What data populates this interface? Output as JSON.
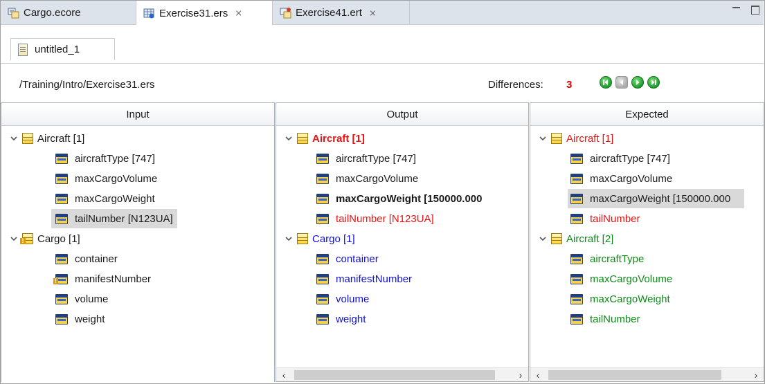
{
  "editor_tabs": [
    {
      "label": "Cargo.ecore",
      "icon": "ecore-model-icon"
    },
    {
      "label": "Exercise31.ers",
      "icon": "ers-file-icon"
    },
    {
      "label": "Exercise41.ert",
      "icon": "ert-file-icon"
    }
  ],
  "close_glyph": "⨯",
  "sub_tab": {
    "label": "untitled_1"
  },
  "path": "/Training/Intro/Exercise31.ers",
  "differences": {
    "label": "Differences:",
    "count": "3"
  },
  "colors": {
    "added": "#0b8a16",
    "removed": "#ee1111",
    "changed": "#1010dd"
  },
  "panels": {
    "input": {
      "title": "Input",
      "rows": [
        {
          "label": "Aircraft [1]"
        },
        {
          "label": "aircraftType [747]"
        },
        {
          "label": "maxCargoVolume"
        },
        {
          "label": "maxCargoWeight"
        },
        {
          "label": "tailNumber [N123UA]"
        },
        {
          "label": "Cargo [1]"
        },
        {
          "label": "container"
        },
        {
          "label": "manifestNumber"
        },
        {
          "label": "volume"
        },
        {
          "label": "weight"
        }
      ]
    },
    "output": {
      "title": "Output",
      "rows": [
        {
          "label": "Aircraft [1]"
        },
        {
          "label": "aircraftType [747]"
        },
        {
          "label": "maxCargoVolume"
        },
        {
          "label": "maxCargoWeight [150000.000"
        },
        {
          "label": "tailNumber [N123UA]"
        },
        {
          "label": "Cargo [1]"
        },
        {
          "label": "container"
        },
        {
          "label": "manifestNumber"
        },
        {
          "label": "volume"
        },
        {
          "label": "weight"
        }
      ]
    },
    "expected": {
      "title": "Expected",
      "rows": [
        {
          "label": "Aircraft [1]"
        },
        {
          "label": "aircraftType [747]"
        },
        {
          "label": "maxCargoVolume"
        },
        {
          "label": "maxCargoWeight [150000.000"
        },
        {
          "label": "tailNumber"
        },
        {
          "label": "Aircraft [2]"
        },
        {
          "label": "aircraftType"
        },
        {
          "label": "maxCargoVolume"
        },
        {
          "label": "maxCargoWeight"
        },
        {
          "label": "tailNumber"
        }
      ]
    }
  },
  "scroll": {
    "left": "‹",
    "right": "›"
  }
}
